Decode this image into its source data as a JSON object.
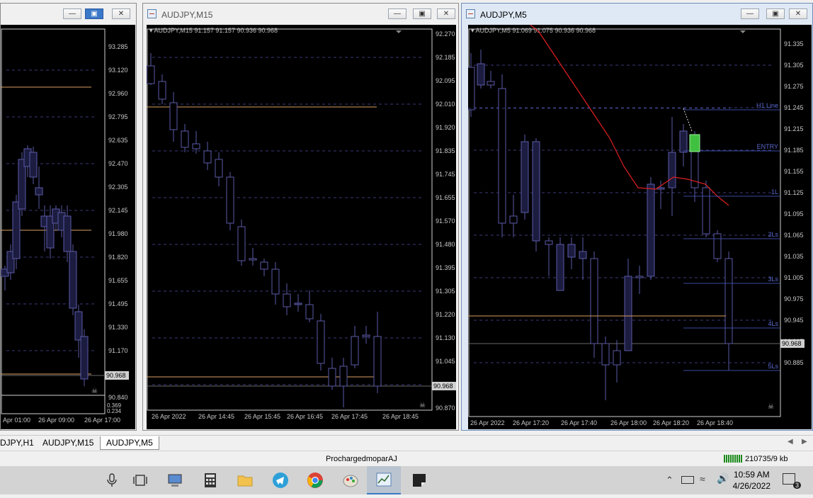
{
  "windows": [
    {
      "id": "h1",
      "title": "",
      "info": "",
      "prices": [
        "93.285",
        "93.120",
        "92.960",
        "92.795",
        "92.635",
        "92.470",
        "92.305",
        "92.145",
        "91.980",
        "91.820",
        "91.655",
        "91.495",
        "91.330",
        "91.170",
        "91.005",
        "90.840"
      ],
      "current_price": "90.968",
      "times": [
        "Apr 01:00",
        "26 Apr 09:00",
        "26 Apr 17:00"
      ],
      "indicator_values": [
        "0.369",
        "0.234"
      ]
    },
    {
      "id": "m15",
      "title": "AUDJPY,M15",
      "info": "AUDJPY,M15  91.157 91.157 90.936 90.968",
      "prices": [
        "92.270",
        "92.185",
        "92.095",
        "92.010",
        "91.920",
        "91.835",
        "91.745",
        "91.655",
        "91.570",
        "91.480",
        "91.395",
        "91.305",
        "91.220",
        "91.130",
        "91.045",
        "90.955",
        "90.870"
      ],
      "current_price": "90.968",
      "times": [
        "26 Apr 2022",
        "26 Apr 14:45",
        "26 Apr 15:45",
        "26 Apr 16:45",
        "26 Apr 17:45",
        "26 Apr 18:45"
      ]
    },
    {
      "id": "m5",
      "title": "AUDJPY,M5",
      "info": "AUDJPY,M5  91.069 91.075 90.936 90.968",
      "prices": [
        "91.335",
        "91.305",
        "91.275",
        "91.245",
        "91.215",
        "91.185",
        "91.155",
        "91.125",
        "91.095",
        "91.065",
        "91.035",
        "91.005",
        "90.975",
        "90.945",
        "90.915",
        "90.885"
      ],
      "current_price": "90.968",
      "times": [
        "26 Apr 2022",
        "26 Apr 17:20",
        "26 Apr 17:40",
        "26 Apr 18:00",
        "26 Apr 18:20",
        "26 Apr 18:40"
      ],
      "line_labels": [
        "H1 Line",
        "ENTRY",
        "1L",
        "2Ls",
        "3Ls",
        "4Ls",
        "5Ls"
      ]
    }
  ],
  "tabs": [
    "DJPY,H1",
    "AUDJPY,M15",
    "AUDJPY,M5"
  ],
  "status": {
    "profile": "ProchargedmoparAJ",
    "traffic": "210735/9 kb"
  },
  "clock": {
    "time": "10:59 AM",
    "date": "4/26/2022"
  },
  "notifications": "3",
  "colors": {
    "chart_bg": "#000000",
    "bull": "#1c1c40",
    "bear": "#000000",
    "candle_edge": "#5a5aa8",
    "grid": "#3a3a7a",
    "hline_orange": "#d8a060",
    "hline_blue": "#3a4aa0",
    "ma_red": "#e02020"
  }
}
